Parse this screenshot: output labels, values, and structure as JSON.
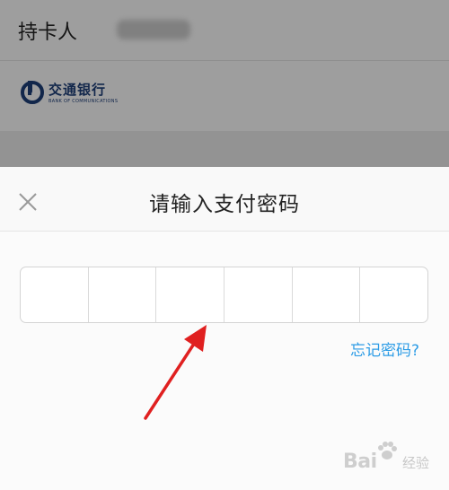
{
  "background": {
    "holder_label": "持卡人",
    "bank_name": "交通银行",
    "bank_name_en": "BANK OF COMMUNICATIONS"
  },
  "sheet": {
    "title": "请输入支付密码",
    "close_icon": "close-icon",
    "digit_count": 6,
    "forgot_link": "忘记密码?"
  },
  "watermark": {
    "brand": "Bai",
    "suffix": "经验"
  },
  "colors": {
    "accent": "#2c9ce6",
    "bank_brand": "#1e3f7a",
    "arrow": "#e02020"
  }
}
